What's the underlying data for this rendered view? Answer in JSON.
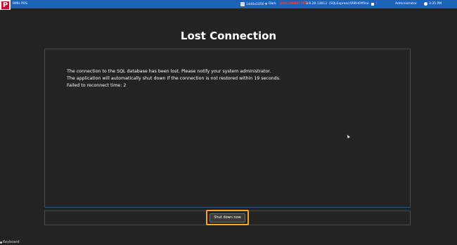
{
  "header": {
    "logo_letter": "P",
    "app_title": "RMH POS",
    "resolution": "1440x1050",
    "mode": "Dark",
    "red_status": "DISCONNECTED",
    "ip_address": "3.9.20.13613",
    "server": "(SQLExpress)\\RMHOffline",
    "count": "1",
    "user": "Administrator",
    "time": "3:35 PM"
  },
  "dialog": {
    "title": "Lost Connection",
    "line1": "The connection to the SQL database has been lost. Please notify your system administrator.",
    "line2": "The application will automatically shut down if the connection is not restored within 19 seconds.",
    "line3": "Failed to reconnect time: 2",
    "shutdown_label": "Shut down now"
  },
  "footer": {
    "keyboard_label": "Keyboard"
  },
  "colors": {
    "topbar": "#1b62b8",
    "background": "#232323",
    "panel_border": "#2b4f79",
    "highlight": "#f5a623",
    "logo_red": "#c8102e"
  },
  "icons": {
    "logo": "app-logo",
    "resolution": "monitor-icon",
    "user": "flag-icon",
    "time": "clock-icon",
    "keyboard": "keyboard-icon"
  }
}
